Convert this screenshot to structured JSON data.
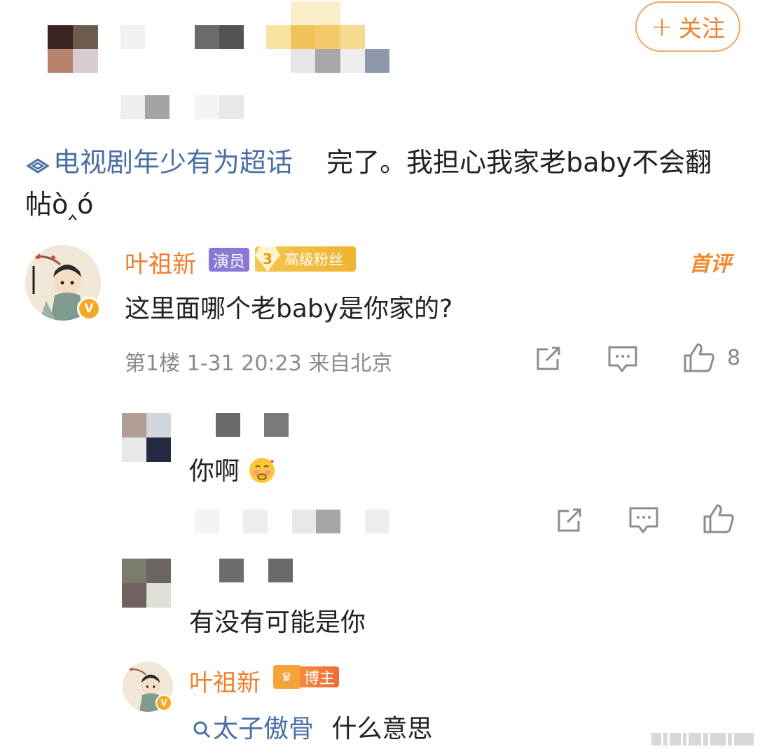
{
  "post": {
    "follow_button": "关注",
    "supertopic": "电视剧年少有为超话",
    "text_line": "完了。我担心我家老baby不会翻帖ò‸ó"
  },
  "comment1": {
    "username": "叶祖新",
    "badge_role": "演员",
    "fan_level": "3",
    "fan_label": "高级粉丝",
    "first_comment_label": "首评",
    "text": "这里面哪个老baby是你家的?",
    "meta": "第1楼 1-31 20:23 来自北京",
    "like_count": "8"
  },
  "reply1": {
    "text": "你啊"
  },
  "reply2": {
    "text": "有没有可能是你"
  },
  "reply3": {
    "username": "叶祖新",
    "badge_label": "博主",
    "search_topic": "太子傲骨",
    "text": "什么意思"
  },
  "colors": {
    "accent_orange": "#ee7f2c",
    "link_blue": "#4a6fa5",
    "role_badge_purple": "#8b78d6",
    "meta_gray": "#8a8a8a"
  }
}
